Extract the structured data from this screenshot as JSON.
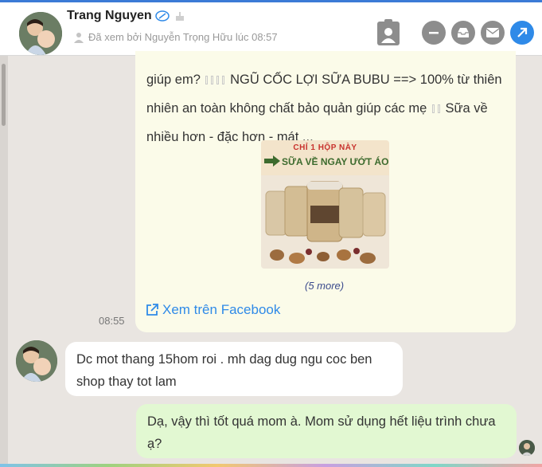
{
  "header": {
    "name": "Trang Nguyen",
    "seen_text": "Đã xem bởi Nguyễn Trọng Hữu lúc 08:57",
    "icons": [
      "link-icon",
      "birthday-cake-icon",
      "person-icon",
      "contact-card-icon",
      "minus-icon",
      "inbox-icon",
      "email-icon",
      "arrow-up-right-icon"
    ]
  },
  "messages": {
    "product": {
      "text_1": "giúp em?",
      "text_2": "NGŨ CỐC LỢI SỮA BUBU ==> 100% từ thiên nhiên an toàn không chất bảo quản giúp các mẹ",
      "text_3": "Sữa về nhiều hơn - đặc hơn - mát ...",
      "promo_line1": "CHỈ 1 HỘP NÀY",
      "promo_line2": "SỮA VỀ NGAY ƯỚT ÁO",
      "more": "(5 more)",
      "fb_link": "Xem trên Facebook",
      "time": "08:55"
    },
    "incoming": {
      "text": "Dc mot thang 15hom roi . mh dag dug ngu coc ben shop thay tot lam"
    },
    "outgoing": {
      "text": "Dạ, vậy thì tốt quá mom à. Mom sử dụng hết liệu trình chưa ạ?"
    }
  },
  "colors": {
    "accent": "#2f8ae8",
    "product_bubble": "#fbfbe9",
    "outgoing_bubble": "#e2f8d2",
    "background": "#e9e5e1"
  }
}
